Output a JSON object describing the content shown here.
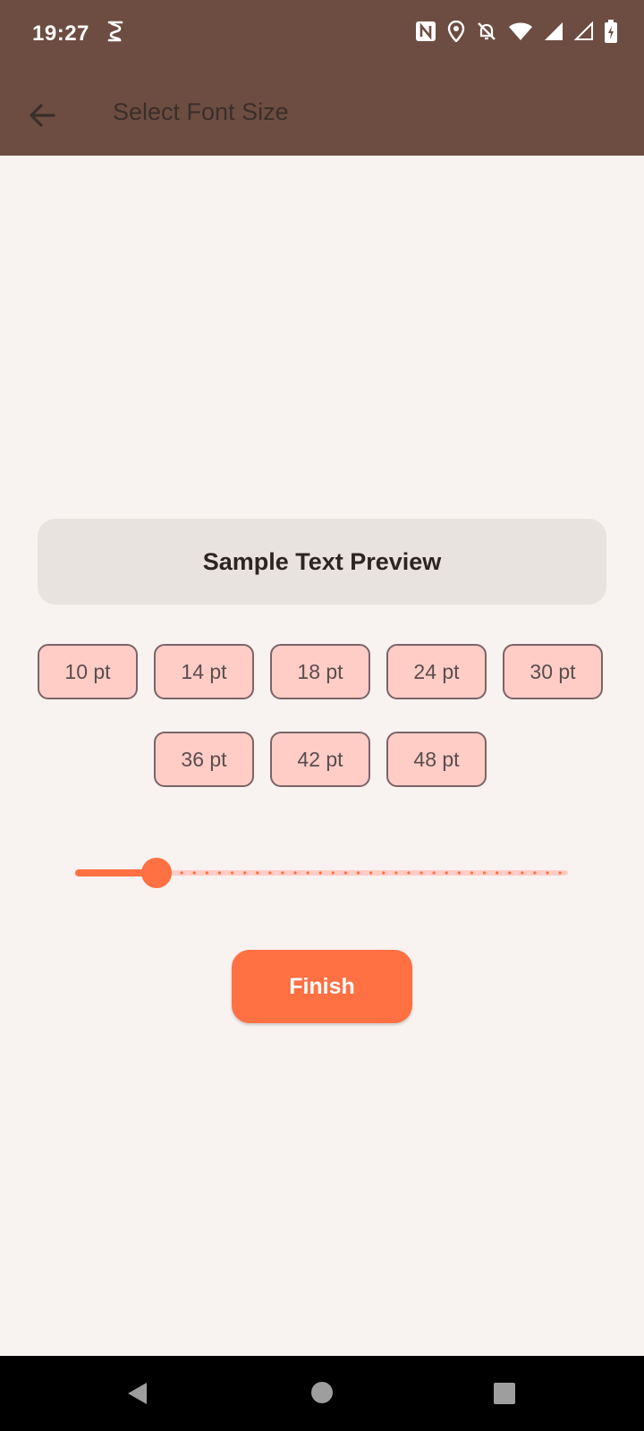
{
  "status_bar": {
    "time": "19:27",
    "icons": [
      "s-app-icon",
      "nfc-icon",
      "location-icon",
      "bell-off-icon",
      "wifi-icon",
      "signal-icon",
      "signal-empty-icon",
      "battery-charging-icon"
    ]
  },
  "app_bar": {
    "title": "Select Font Size",
    "back_icon": "arrow-back-icon"
  },
  "preview": {
    "text": "Sample Text Preview"
  },
  "font_sizes": {
    "row1": [
      "10 pt",
      "14 pt",
      "18 pt",
      "24 pt",
      "30 pt"
    ],
    "row2": [
      "36 pt",
      "42 pt",
      "48 pt"
    ]
  },
  "slider": {
    "value_fraction": 0.16
  },
  "finish": {
    "label": "Finish"
  },
  "colors": {
    "app_bar": "#6D4D42",
    "background": "#F8F3F0",
    "accent": "#FF7043",
    "chip_fill": "#FFCDC6",
    "preview_fill": "#E9E3DF"
  },
  "nav_bar": {
    "icons": [
      "nav-back-icon",
      "nav-home-icon",
      "nav-recents-icon"
    ]
  }
}
